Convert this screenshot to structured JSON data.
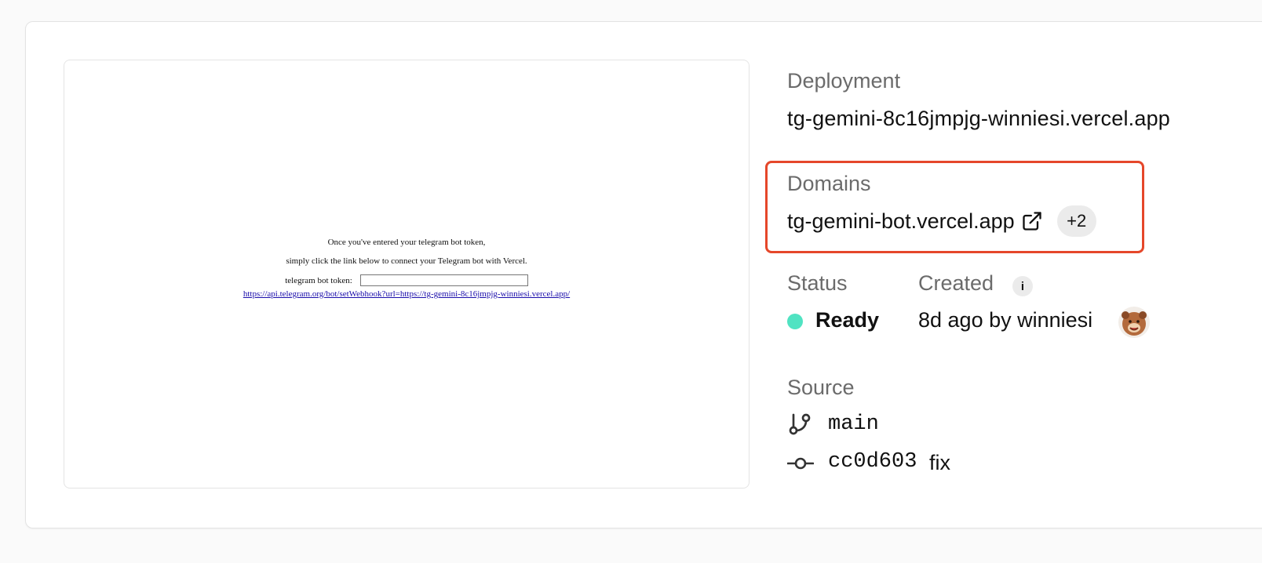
{
  "preview": {
    "line1": "Once you've entered your telegram bot token,",
    "line2": "simply click the link below to connect your Telegram bot with Vercel.",
    "token_label": "telegram bot token:",
    "token_value": "",
    "link": "https://api.telegram.org/bot/setWebhook?url=https://tg-gemini-8c16jmpjg-winniesi.vercel.app/"
  },
  "deployment": {
    "label": "Deployment",
    "url": "tg-gemini-8c16jmpjg-winniesi.vercel.app"
  },
  "domains": {
    "label": "Domains",
    "primary": "tg-gemini-bot.vercel.app",
    "more_badge": "+2",
    "icon": "external-link-icon"
  },
  "status": {
    "label": "Status",
    "value": "Ready",
    "color": "#50e3c2"
  },
  "created": {
    "label": "Created",
    "info_icon": "i",
    "value": "8d ago by winniesi"
  },
  "source": {
    "label": "Source",
    "branch": "main",
    "commit_hash": "cc0d603",
    "commit_message": "fix"
  },
  "colors": {
    "highlight_border": "#e5472a",
    "ready_dot": "#50e3c2"
  }
}
